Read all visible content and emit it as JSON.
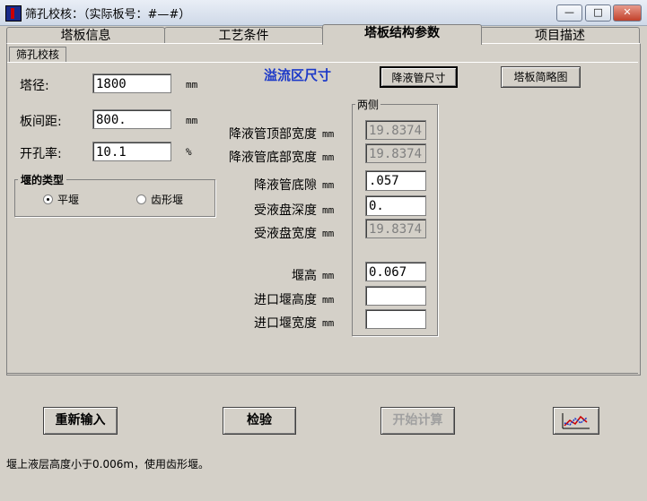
{
  "window": {
    "title": "筛孔校核：（实际板号：#—#）"
  },
  "tabs": [
    {
      "label": "塔板信息"
    },
    {
      "label": "工艺条件"
    },
    {
      "label": "塔板结构参数"
    },
    {
      "label": "项目描述"
    }
  ],
  "subtab": {
    "label": "筛孔校核"
  },
  "left": {
    "diameter": {
      "label": "塔径:",
      "value": "1800",
      "unit": "mm"
    },
    "spacing": {
      "label": "板间距:",
      "value": "800.",
      "unit": "mm"
    },
    "open_ratio": {
      "label": "开孔率:",
      "value": "10.1",
      "unit": "%"
    },
    "weir_type": {
      "label": "堰的类型",
      "flat": "平堰",
      "serrated": "齿形堰",
      "selected": "flat"
    }
  },
  "overflow": {
    "heading": "溢流区尺寸",
    "downcomer_button": "降液管尺寸",
    "sketch_button": "塔板简略图",
    "group_label": "两侧",
    "rows": [
      {
        "label": "降液管顶部宽度",
        "unit": "mm",
        "value": "19.8374",
        "readonly": true
      },
      {
        "label": "降液管底部宽度",
        "unit": "mm",
        "value": "19.8374",
        "readonly": true
      },
      {
        "label": "降液管底隙",
        "unit": "mm",
        "value": ".057",
        "readonly": false
      },
      {
        "label": "受液盘深度",
        "unit": "mm",
        "value": "0.",
        "readonly": false
      },
      {
        "label": "受液盘宽度",
        "unit": "mm",
        "value": "19.8374",
        "readonly": true
      },
      {
        "label": "堰高",
        "unit": "mm",
        "value": "0.067",
        "readonly": false
      },
      {
        "label": "进口堰高度",
        "unit": "mm",
        "value": "",
        "readonly": false
      },
      {
        "label": "进口堰宽度",
        "unit": "mm",
        "value": "",
        "readonly": false
      }
    ]
  },
  "buttons": {
    "reset": "重新输入",
    "check": "检验",
    "compute": "开始计算"
  },
  "status": "堰上液层高度小于0.006m，使用齿形堰。",
  "icons": {
    "chart_button": "line-chart-icon"
  }
}
